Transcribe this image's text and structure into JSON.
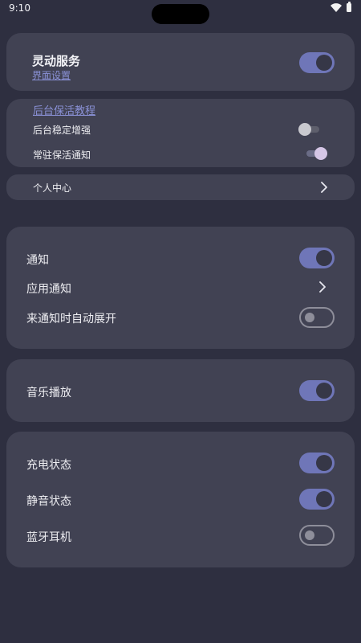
{
  "status_bar": {
    "time": "9:10",
    "wifi_icon": "wifi-icon",
    "battery_icon": "battery-icon"
  },
  "service_card": {
    "title": "灵动服务",
    "link": "界面设置",
    "toggle_on": true
  },
  "background_card": {
    "tutorial_link": "后台保活教程",
    "stable_label": "后台稳定增强",
    "stable_on": false,
    "notify_label": "常驻保活通知",
    "notify_on": true
  },
  "profile": {
    "label": "个人中心",
    "icon": "chevron-right-icon"
  },
  "notification_card": {
    "notify_label": "通知",
    "notify_on": true,
    "app_notify_label": "应用通知",
    "auto_expand_label": "来通知时自动展开",
    "auto_expand_on": false
  },
  "music_card": {
    "label": "音乐播放",
    "on": true
  },
  "status_card": {
    "charging_label": "充电状态",
    "charging_on": true,
    "mute_label": "静音状态",
    "mute_on": true,
    "bluetooth_label": "蓝牙耳机",
    "bluetooth_on": false
  },
  "colors": {
    "background": "#2e2f40",
    "card": "#414253",
    "accent": "#6f76b8",
    "link": "#8a91d6"
  }
}
